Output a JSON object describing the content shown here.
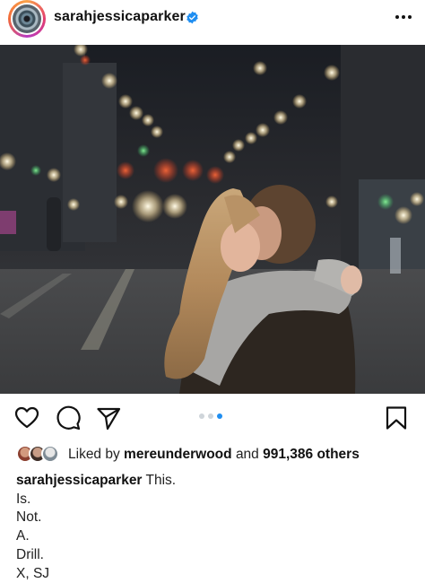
{
  "header": {
    "username": "sarahjessicaparker",
    "verified_icon": "verified-badge-icon",
    "more_icon": "more-options-icon",
    "accent_color": "#1f8ef1"
  },
  "post": {
    "photo_description_icon": "post-photo",
    "carousel": {
      "total": 3,
      "active_index": 3
    }
  },
  "actions": {
    "like_icon": "heart-icon",
    "comment_icon": "comment-icon",
    "share_icon": "share-icon",
    "save_icon": "bookmark-icon"
  },
  "likes": {
    "prefix": "Liked by",
    "user": "mereunderwood",
    "connector": "and",
    "others": "991,386 others"
  },
  "caption": {
    "username": "sarahjessicaparker",
    "first_line": "This.",
    "lines": [
      "Is.",
      "Not.",
      "A.",
      "Drill.",
      "X, SJ"
    ]
  }
}
